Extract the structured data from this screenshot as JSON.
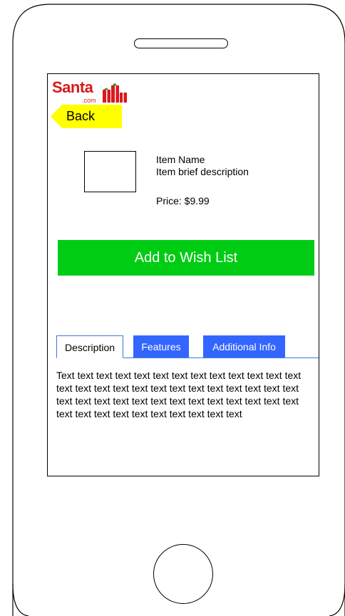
{
  "logo": {
    "text": "Santa",
    "domain": ".com"
  },
  "back_label": "Back",
  "item": {
    "name": "Item Name",
    "description": "Item brief description",
    "price": "Price: $9.99"
  },
  "wish_button_label": "Add to Wish List",
  "tabs": [
    {
      "label": "Description",
      "selected": true
    },
    {
      "label": "Features",
      "selected": false
    },
    {
      "label": "Additional Info",
      "selected": false
    }
  ],
  "description_text": "Text text text text text text text text text text text text text text text text text text text text text text text text text text text text text text text text text text text text text text text text text text text text text text text text text",
  "colors": {
    "wish_button": "#00cc14",
    "tab_active_border": "#3a78d8",
    "tab_inactive": "#3366ff",
    "back_arrow": "#ffff00",
    "logo_red": "#d7191c"
  }
}
